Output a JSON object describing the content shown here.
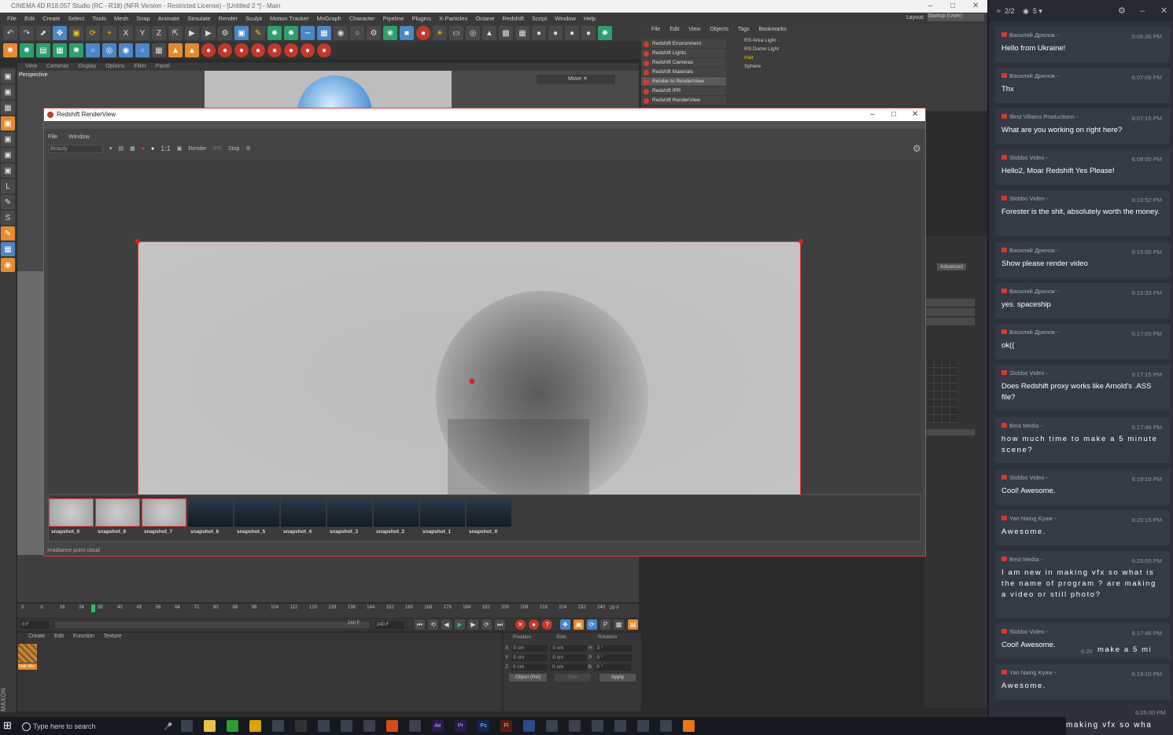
{
  "app": {
    "title": "CINEMA 4D R18.057 Studio (RC - R18) (NFR Version - Restricted License) - [Untitled 2 *] - Main",
    "menus": [
      "File",
      "Edit",
      "Create",
      "Select",
      "Tools",
      "Mesh",
      "Snap",
      "Animate",
      "Simulate",
      "Render",
      "Sculpt",
      "Motion Tracker",
      "MoGraph",
      "Character",
      "Pipeline",
      "Plugins",
      "X-Particles",
      "Octane",
      "Redshift",
      "Script",
      "Window",
      "Help"
    ],
    "layout_label": "Layout:",
    "layout_value": "Startup (User)"
  },
  "viewport": {
    "menus": [
      "View",
      "Cameras",
      "Display",
      "Options",
      "Filter",
      "Panel"
    ],
    "label": "Perspective",
    "move_label": "Move ✕"
  },
  "object_manager": {
    "menus": [
      "File",
      "Edit",
      "View",
      "Objects",
      "Tags",
      "Bookmarks"
    ],
    "objects": [
      "RS Area Light",
      "RS Dome Light",
      "Hair",
      "Sphere"
    ]
  },
  "redshift_menu": [
    "Redshift Environment",
    "Redshift Lights",
    "Redshift Cameras",
    "Redshift Materials",
    "Render to RenderView",
    "Redshift IPR",
    "Redshift RenderView"
  ],
  "attributes": {
    "tab": "Advanced"
  },
  "renderview": {
    "title": "Redshift RenderView",
    "menus": [
      "File",
      "Window"
    ],
    "aov": "Beauty",
    "ratio": "1:1",
    "render_label": "Render",
    "ipr_label": "IPR",
    "stop_label": "Stop",
    "snapshots": [
      "snapshot_9",
      "snapshot_8",
      "snapshot_7",
      "snapshot_6",
      "snapshot_5",
      "snapshot_4",
      "snapshot_3",
      "snapshot_2",
      "snapshot_1",
      "snapshot_0"
    ],
    "status": "Irradiance point cloud"
  },
  "timeline": {
    "ticks": [
      "0",
      "8",
      "16",
      "24",
      "32",
      "40",
      "48",
      "56",
      "64",
      "72",
      "80",
      "88",
      "96",
      "104",
      "112",
      "120",
      "128",
      "136",
      "144",
      "152",
      "160",
      "168",
      "176",
      "184",
      "192",
      "200",
      "208",
      "216",
      "224",
      "232",
      "240"
    ],
    "current": "29",
    "end_frame": "29 F",
    "start_field": "0 F",
    "range_end": "240 F",
    "max_field": "240 F"
  },
  "materials": {
    "menus": [
      "Create",
      "Edit",
      "Function",
      "Texture"
    ],
    "material_name": "Hair Ma"
  },
  "coordinates": {
    "headers": [
      "Position",
      "Size",
      "Rotation"
    ],
    "rows": [
      {
        "axis": "X",
        "pos": "0 cm",
        "size": "0 cm",
        "rot_label": "H",
        "rot": "0 °"
      },
      {
        "axis": "Y",
        "pos": "0 cm",
        "size": "0 cm",
        "rot_label": "P",
        "rot": "0 °"
      },
      {
        "axis": "Z",
        "pos": "0 cm",
        "size": "0 cm",
        "rot_label": "B",
        "rot": "0 °"
      }
    ],
    "object_mode": "Object (Rel)",
    "size_mode": "Size",
    "apply": "Apply"
  },
  "chat": {
    "header_count": "2/2",
    "viewers": "5",
    "messages": [
      {
        "user": "Василий Дрючок -",
        "time": "6:06:26 PM",
        "text": "Hello from Ukraine!",
        "wide": false
      },
      {
        "user": "Василий Дрючок -",
        "time": "6:07:08 PM",
        "text": "Thx",
        "wide": false
      },
      {
        "user": "Illest Villains Productions -",
        "time": "6:07:15 PM",
        "text": "What are you working on right here?",
        "wide": false
      },
      {
        "user": "Slobbo Video -",
        "time": "6:08:00 PM",
        "text": "Hello2, Moar Redshift Yes Please!",
        "wide": false
      },
      {
        "user": "Slobbo Video -",
        "time": "6:10:52 PM",
        "text": "Forester is the shit, absolutely worth the money.",
        "wide": false
      },
      {
        "user": "Василий Дрючок -",
        "time": "6:15:50 PM",
        "text": "Show please render video",
        "wide": false
      },
      {
        "user": "Василий Дрючок -",
        "time": "6:16:33 PM",
        "text": "yes. spaceship",
        "wide": false
      },
      {
        "user": "Василий Дрючок -",
        "time": "6:17:05 PM",
        "text": "ok((",
        "wide": false
      },
      {
        "user": "Slobbo Video -",
        "time": "6:17:15 PM",
        "text": "Does Redshift proxy works like Arnold's .ASS file?",
        "wide": false
      },
      {
        "user": "Best Media -",
        "time": "6:17:46 PM",
        "text": "how much time to make a 5 minute scene?",
        "wide": true
      },
      {
        "user": "Slobbo Video -",
        "time": "6:19:10 PM",
        "text": "Cool! Awesome.",
        "wide": false
      },
      {
        "user": "Yan Naing Kyaw -",
        "time": "6:20:15 PM",
        "text": "Awesome.",
        "wide": true
      },
      {
        "user": "Best Media -",
        "time": "6:25:00 PM",
        "text": "I am new in making vfx so what is the name of program ? are making a video or still photo?",
        "wide": true
      },
      {
        "user": "Slobbo Video -",
        "time": "6:17:46 PM",
        "text": "Cool! Awesome.",
        "wide": false
      },
      {
        "user": "Yan Naing Kyaw -",
        "time": "6:19:10 PM",
        "text": "Awesome.",
        "wide": true
      }
    ],
    "overlap_time": "6:20",
    "overlap_text": "make a 5 mi",
    "footer_time": "6:25:00 PM",
    "footer_text": "making vfx so wha"
  },
  "taskbar": {
    "search_placeholder": "Type here to search",
    "icons": [
      "task-view-icon",
      "file-explorer-icon",
      "camtasia-icon",
      "chrome-icon",
      "davinci-icon",
      "obs-icon",
      "app-icon",
      "windows-explorer-icon",
      "app-icon",
      "houdini-icon",
      "app-icon",
      "after-effects-icon",
      "premiere-icon",
      "photoshop-icon",
      "flash-icon",
      "c4d-icon",
      "app-icon",
      "app-icon",
      "app-icon",
      "app-icon",
      "app-icon",
      "app-icon",
      "blender-icon"
    ]
  }
}
